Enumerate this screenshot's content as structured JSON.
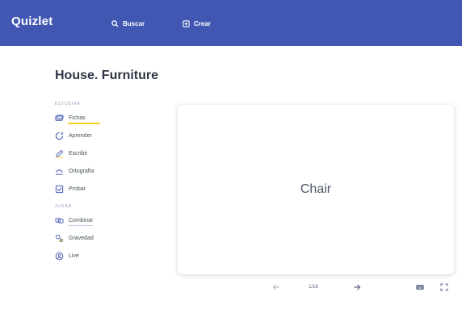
{
  "header": {
    "logo": "Quizlet",
    "search_label": "Buscar",
    "create_label": "Crear",
    "bg_color": "#4257b2"
  },
  "set": {
    "title": "House. Furniture"
  },
  "sidebar": {
    "study_section": "ESTUDIAR",
    "study_items": [
      {
        "label": "Fichas",
        "icon": "cards-icon"
      },
      {
        "label": "Aprender",
        "icon": "learn-icon"
      },
      {
        "label": "Escribir",
        "icon": "write-icon"
      },
      {
        "label": "Ortografía",
        "icon": "spell-icon"
      },
      {
        "label": "Probar",
        "icon": "test-icon"
      }
    ],
    "play_section": "JUGAR",
    "play_items": [
      {
        "label": "Combinar",
        "icon": "match-icon"
      },
      {
        "label": "Gravedad",
        "icon": "gravity-icon"
      },
      {
        "label": "Live",
        "icon": "live-icon"
      }
    ],
    "accent_color": "#ffcd1f"
  },
  "card": {
    "term": "Chair"
  },
  "controls": {
    "progress": "1/16"
  }
}
